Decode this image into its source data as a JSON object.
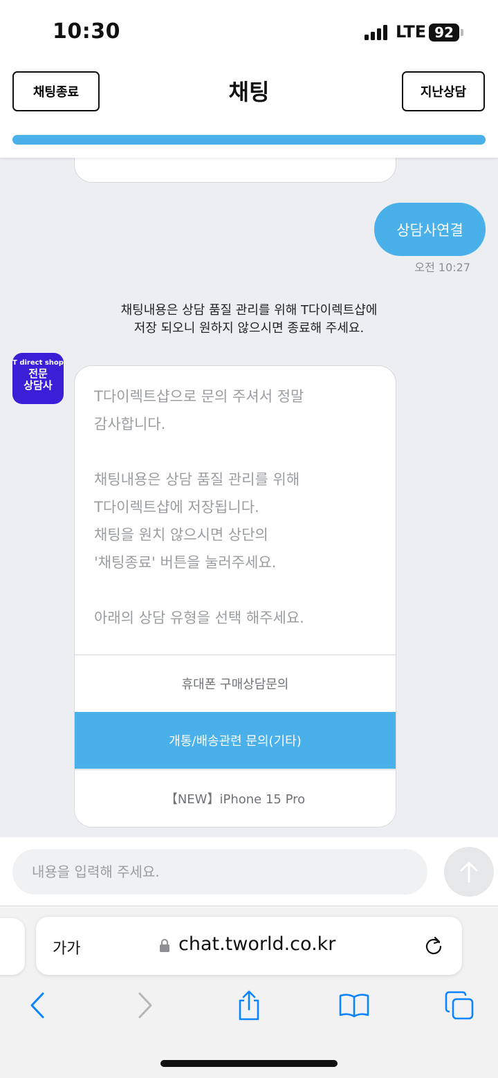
{
  "status": {
    "time": "10:30",
    "network": "LTE",
    "battery": "92"
  },
  "header": {
    "left_button": "채팅종료",
    "title": "채팅",
    "right_button": "지난상담",
    "progress": 1.0
  },
  "chat": {
    "user_message": {
      "text": "상담사연결",
      "time": "오전 10:27"
    },
    "notice_lines": [
      "채팅내용은 상담 품질 관리를 위해 T다이렉트샵에",
      "저장 되오니 원하지 않으시면 종료해 주세요."
    ],
    "agent": {
      "brand": "T direct shop",
      "name_line1": "전문",
      "name_line2": "상담사"
    },
    "bot_message": {
      "lines": [
        "T다이렉트샵으로 문의 주셔서 정말",
        "감사합니다.",
        "",
        "채팅내용은 상담 품질 관리를 위해",
        "T다이렉트샵에 저장됩니다.",
        "채팅을 원치 않으시면 상단의",
        "'채팅종료' 버튼을 눌러주세요.",
        "",
        "아래의 상담 유형을 선택 해주세요."
      ],
      "options": [
        "휴대폰 구매상담문의",
        "개통/배송관련 문의(기타)",
        "【NEW】iPhone 15 Pro"
      ]
    }
  },
  "input": {
    "placeholder": "내용을 입력해 주세요."
  },
  "browser": {
    "aa_label": "가가",
    "url": "chat.tworld.co.kr"
  },
  "colors": {
    "accent": "#49b0ea",
    "agent_badge": "#3a1fd6",
    "chat_bg": "#eceef1",
    "ios_blue": "#0a84ff"
  },
  "icons": [
    "lock-icon",
    "reload-icon",
    "back-icon",
    "forward-icon",
    "share-icon",
    "bookmarks-icon",
    "tabs-icon",
    "send-arrow-icon"
  ]
}
